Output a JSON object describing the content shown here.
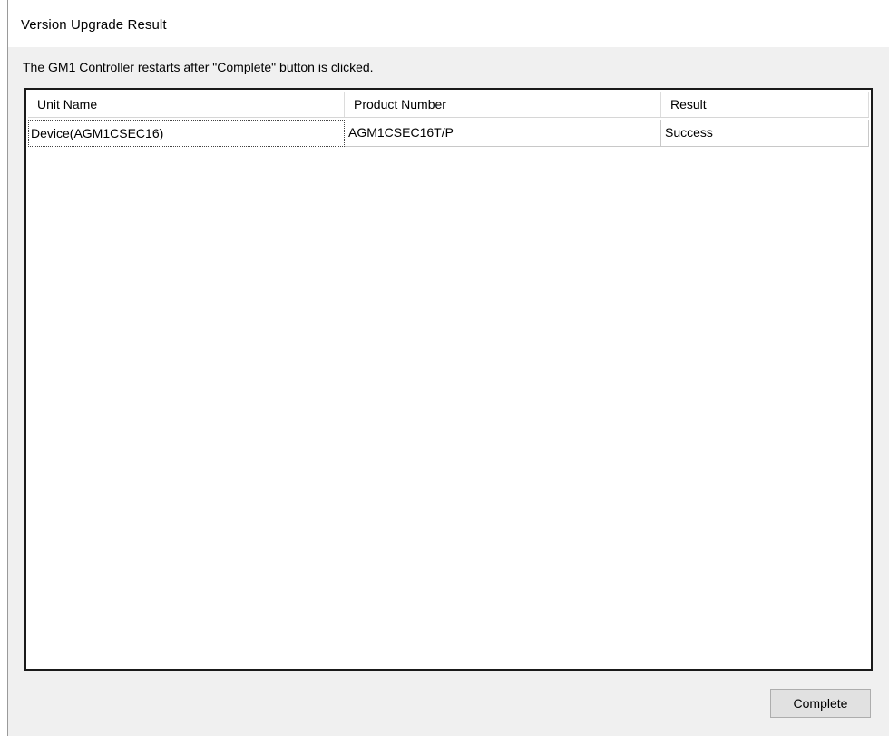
{
  "window": {
    "title": "Version Upgrade Result"
  },
  "message": "The GM1 Controller restarts after \"Complete\" button is clicked.",
  "table": {
    "columns": [
      "Unit Name",
      "Product Number",
      "Result"
    ],
    "rows": [
      {
        "unit_name": "Device(AGM1CSEC16)",
        "product_number": "AGM1CSEC16T/P",
        "result": "Success"
      }
    ]
  },
  "buttons": {
    "complete_label": "Complete"
  }
}
